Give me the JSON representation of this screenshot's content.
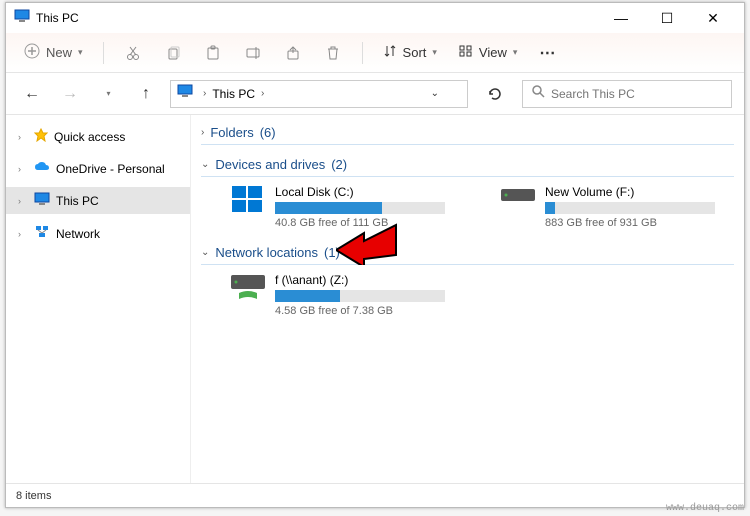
{
  "window": {
    "title": "This PC"
  },
  "toolbar": {
    "new_label": "New",
    "sort_label": "Sort",
    "view_label": "View"
  },
  "breadcrumb": {
    "root": "This PC"
  },
  "search": {
    "placeholder": "Search This PC"
  },
  "sidebar": {
    "items": [
      {
        "label": "Quick access"
      },
      {
        "label": "OneDrive - Personal"
      },
      {
        "label": "This PC"
      },
      {
        "label": "Network"
      }
    ]
  },
  "sections": {
    "folders": {
      "label": "Folders",
      "count_suffix": "(6)"
    },
    "devices": {
      "label": "Devices and drives",
      "count_suffix": "(2)"
    },
    "network": {
      "label": "Network locations",
      "count_suffix": "(1)"
    }
  },
  "drives": {
    "c": {
      "name": "Local Disk (C:)",
      "free": "40.8 GB free of 111 GB",
      "fill_pct": 63
    },
    "f": {
      "name": "New Volume (F:)",
      "free": "883 GB free of 931 GB",
      "fill_pct": 6
    },
    "z": {
      "name": "f (\\\\anant) (Z:)",
      "free": "4.58 GB free of 7.38 GB",
      "fill_pct": 38
    }
  },
  "status": {
    "items": "8 items"
  },
  "watermark": "www.deuaq.com"
}
